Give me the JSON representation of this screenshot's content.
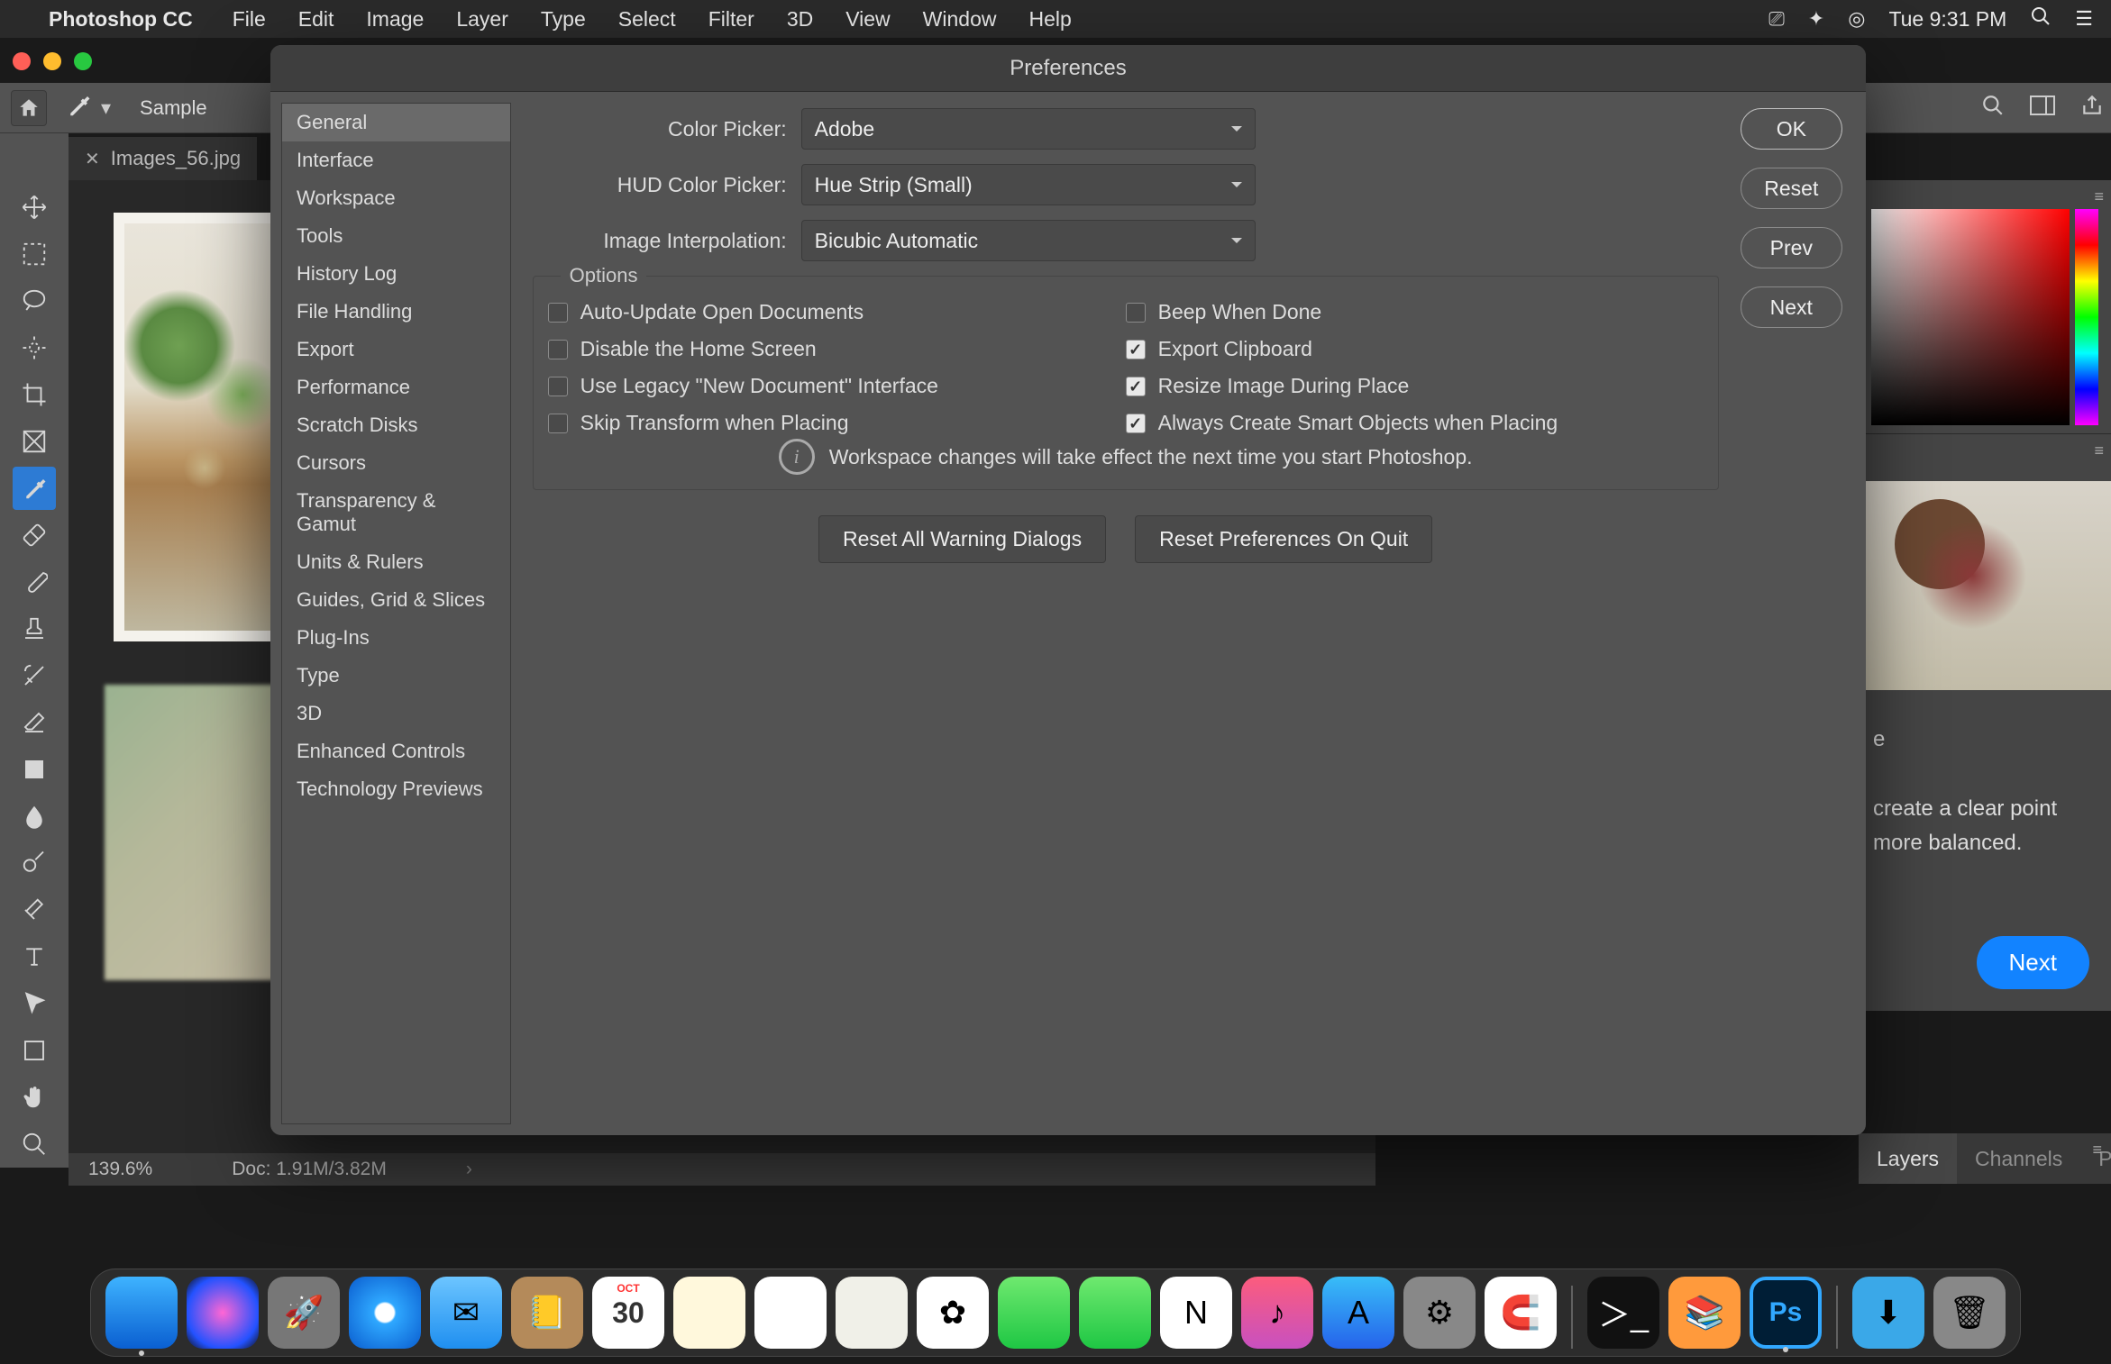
{
  "menubar": {
    "app": "Photoshop CC",
    "items": [
      "File",
      "Edit",
      "Image",
      "Layer",
      "Type",
      "Select",
      "Filter",
      "3D",
      "View",
      "Window",
      "Help"
    ],
    "time": "Tue 9:31 PM"
  },
  "optionsBar": {
    "sample": "Sample"
  },
  "docTab": {
    "name": "Images_56.jpg"
  },
  "statusBar": {
    "zoom": "139.6%",
    "doc": "Doc: 1.91M/3.82M"
  },
  "dialog": {
    "title": "Preferences",
    "sidebar": [
      "General",
      "Interface",
      "Workspace",
      "Tools",
      "History Log",
      "File Handling",
      "Export",
      "Performance",
      "Scratch Disks",
      "Cursors",
      "Transparency & Gamut",
      "Units & Rulers",
      "Guides, Grid & Slices",
      "Plug-Ins",
      "Type",
      "3D",
      "Enhanced Controls",
      "Technology Previews"
    ],
    "selectedIndex": 0,
    "fields": {
      "colorPicker": {
        "label": "Color Picker:",
        "value": "Adobe"
      },
      "hud": {
        "label": "HUD Color Picker:",
        "value": "Hue Strip (Small)"
      },
      "interp": {
        "label": "Image Interpolation:",
        "value": "Bicubic Automatic"
      }
    },
    "optionsLegend": "Options",
    "checks": {
      "left": [
        {
          "label": "Auto-Update Open Documents",
          "checked": false
        },
        {
          "label": "Disable the Home Screen",
          "checked": false
        },
        {
          "label": "Use Legacy \"New Document\" Interface",
          "checked": false
        },
        {
          "label": "Skip Transform when Placing",
          "checked": false
        }
      ],
      "right": [
        {
          "label": "Beep When Done",
          "checked": false
        },
        {
          "label": "Export Clipboard",
          "checked": true
        },
        {
          "label": "Resize Image During Place",
          "checked": true
        },
        {
          "label": "Always Create Smart Objects when Placing",
          "checked": true
        }
      ]
    },
    "info": "Workspace changes will take effect the next time you start Photoshop.",
    "resetWarnings": "Reset All Warning Dialogs",
    "resetPrefs": "Reset Preferences On Quit",
    "buttons": {
      "ok": "OK",
      "reset": "Reset",
      "prev": "Prev",
      "next": "Next"
    }
  },
  "rightPanels": {
    "learnText1": "e",
    "learnText2": "create a clear point",
    "learnText3": "more balanced.",
    "next": "Next",
    "layersTabs": [
      "Layers",
      "Channels",
      "Paths"
    ]
  },
  "dock": {
    "apps": [
      {
        "id": "finder",
        "glyph": "",
        "cls": "da-finder",
        "dot": true
      },
      {
        "id": "siri",
        "glyph": "",
        "cls": "da-siri"
      },
      {
        "id": "launchpad",
        "glyph": "🚀",
        "cls": "da-launch"
      },
      {
        "id": "safari",
        "glyph": "",
        "cls": "da-safari"
      },
      {
        "id": "mail",
        "glyph": "✉︎",
        "cls": "da-mail"
      },
      {
        "id": "contacts",
        "glyph": "📒",
        "cls": "da-contacts"
      },
      {
        "id": "calendar",
        "glyph": "",
        "cls": "da-cal"
      },
      {
        "id": "notes",
        "glyph": "",
        "cls": "da-notes"
      },
      {
        "id": "reminders",
        "glyph": "",
        "cls": "da-rem"
      },
      {
        "id": "maps",
        "glyph": "",
        "cls": "da-maps"
      },
      {
        "id": "photos",
        "glyph": "✿",
        "cls": "da-photos"
      },
      {
        "id": "messages",
        "glyph": "",
        "cls": "da-msg"
      },
      {
        "id": "facetime",
        "glyph": "",
        "cls": "da-ft"
      },
      {
        "id": "news",
        "glyph": "N",
        "cls": "da-news"
      },
      {
        "id": "music",
        "glyph": "♪",
        "cls": "da-music"
      },
      {
        "id": "appstore",
        "glyph": "A",
        "cls": "da-store"
      },
      {
        "id": "syspref",
        "glyph": "⚙︎",
        "cls": "da-sys"
      },
      {
        "id": "magnet",
        "glyph": "🧲",
        "cls": "da-magnet"
      }
    ],
    "cal": {
      "mon": "OCT",
      "day": "30"
    },
    "ps": "Ps"
  }
}
